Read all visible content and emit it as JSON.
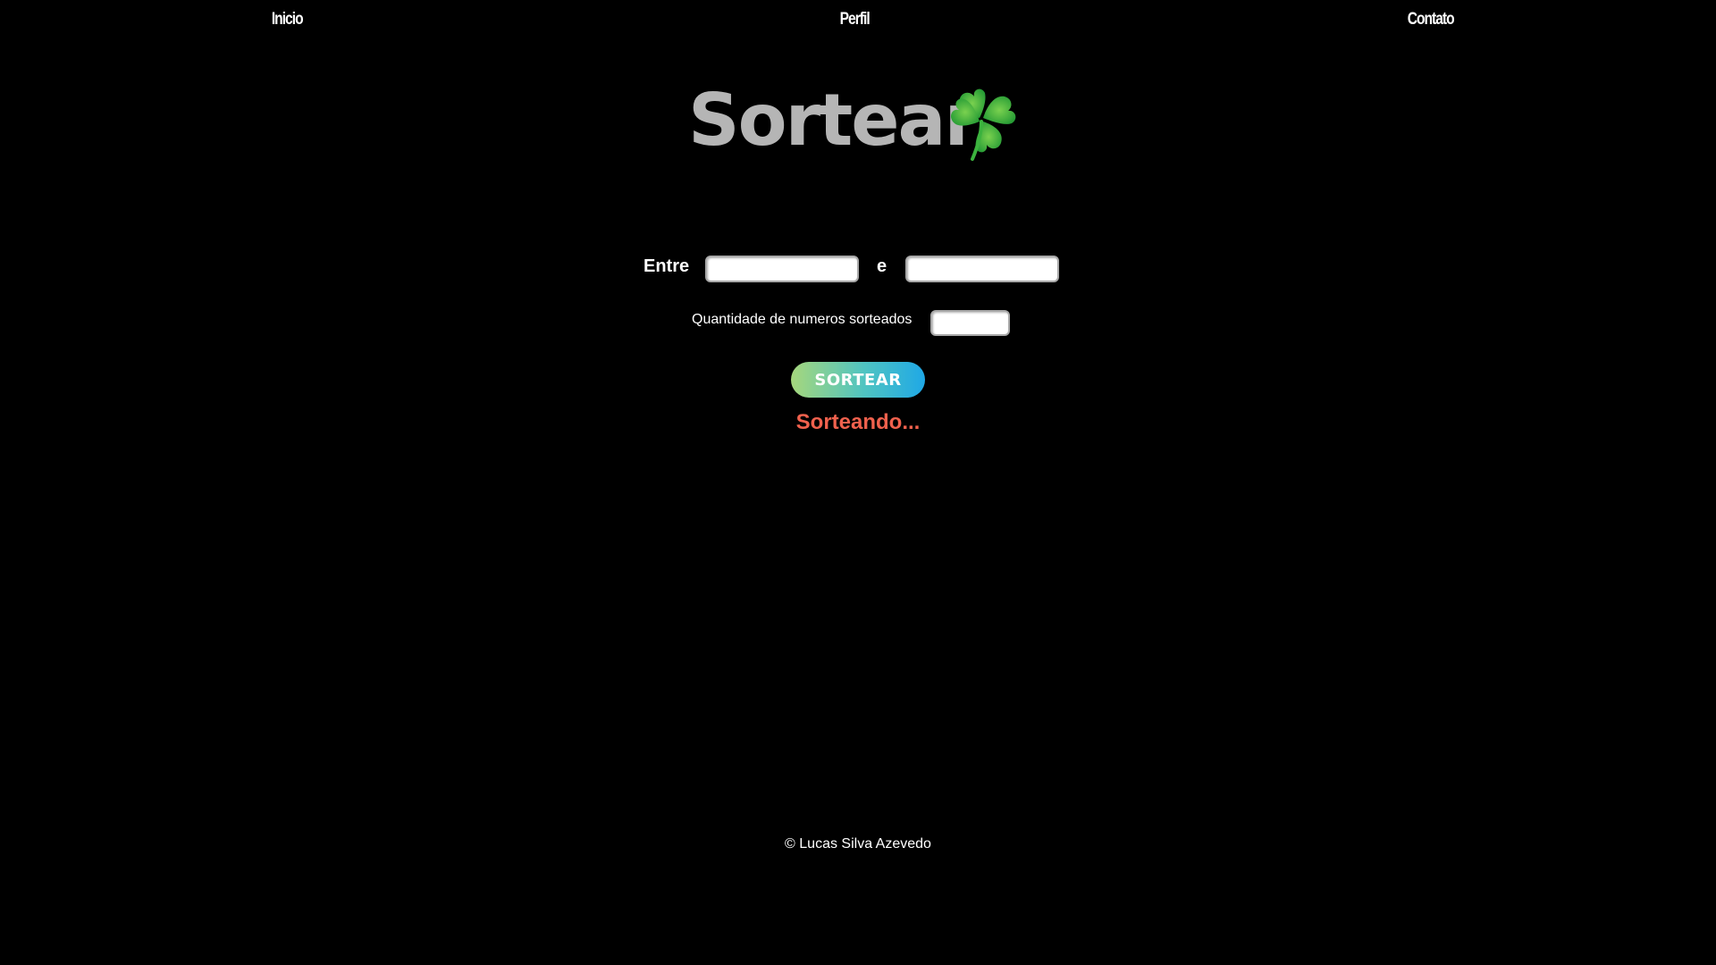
{
  "nav": {
    "items": [
      {
        "label": "Inicio"
      },
      {
        "label": "Perfil"
      },
      {
        "label": "Contato"
      }
    ]
  },
  "logo": {
    "text": "Sortear",
    "icon": "four-leaf-clover-icon",
    "text_color": "#b5b5b5",
    "icon_color": "#3cb33e"
  },
  "range": {
    "label_from": "Entre",
    "label_to": "e",
    "min_value": "",
    "max_value": ""
  },
  "quantity": {
    "label": "Quantidade de numeros sorteados",
    "value": ""
  },
  "button": {
    "label": "SORTEAR",
    "gradient_start": "#a6d77c",
    "gradient_end": "#1fa8e6"
  },
  "status": {
    "text": "Sorteando...",
    "color": "#f0614d"
  },
  "footer": {
    "text": "© Lucas Silva Azevedo"
  }
}
